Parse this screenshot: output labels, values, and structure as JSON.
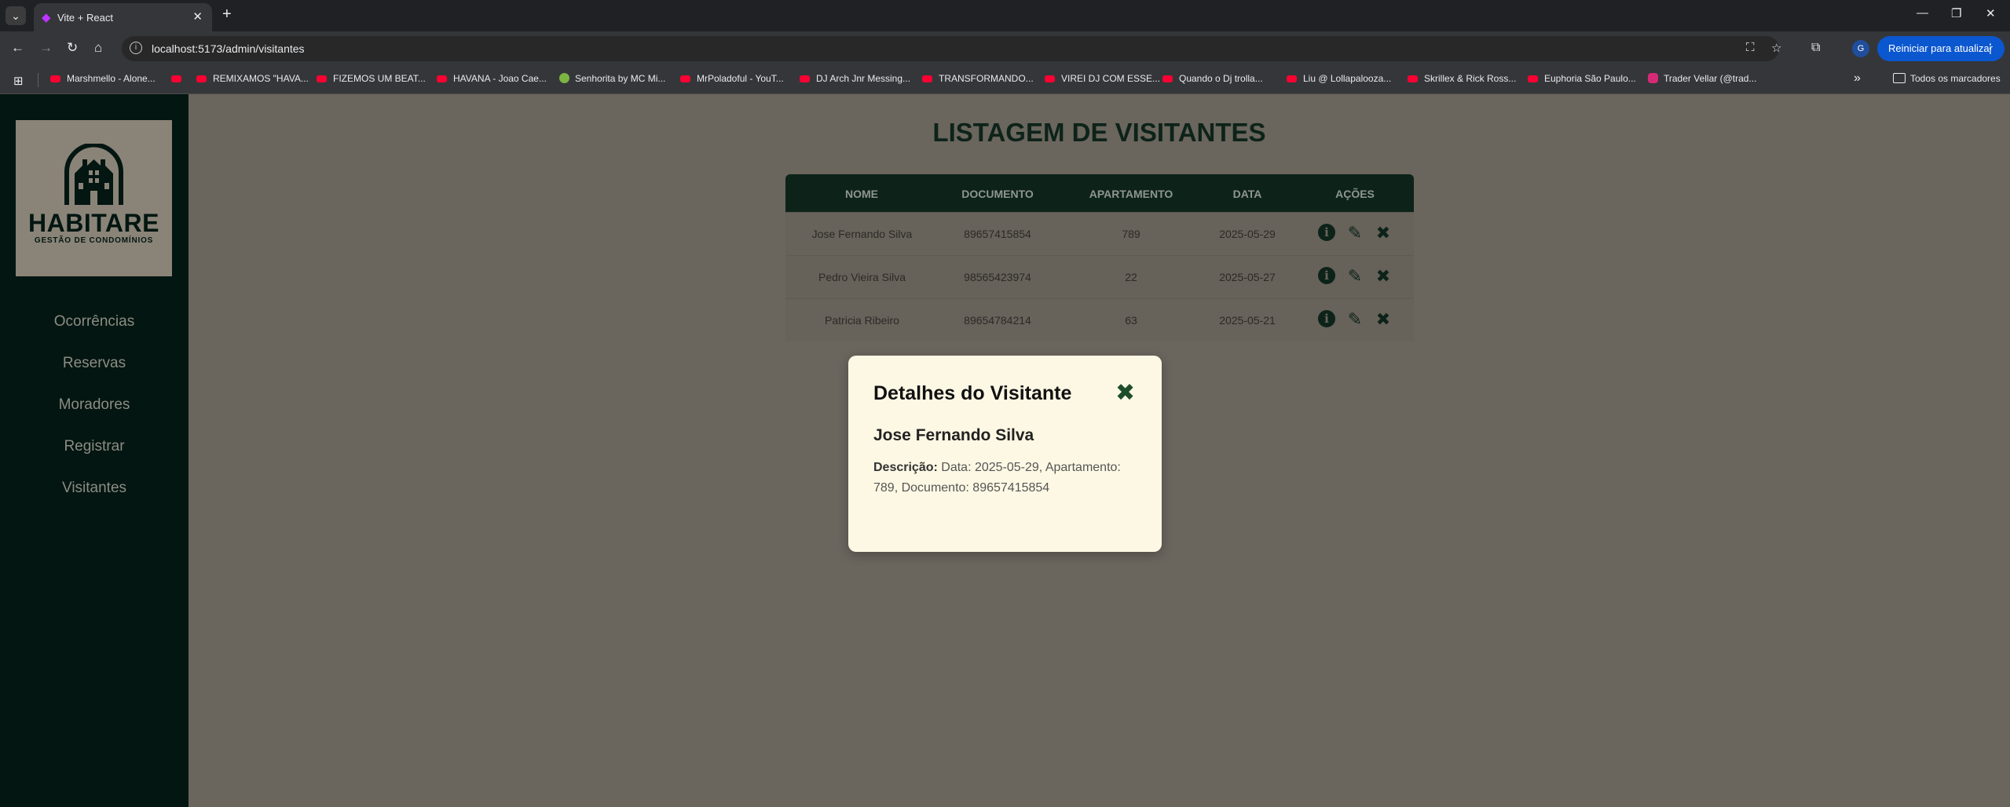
{
  "browser": {
    "tab_title": "Vite + React",
    "url": "localhost:5173/admin/visitantes",
    "update_button": "Reiniciar para atualizar",
    "profile_initial": "G",
    "bookmarks": [
      {
        "label": "Marshmello - Alone...",
        "icon": "youtube"
      },
      {
        "label": "",
        "icon": "youtube"
      },
      {
        "label": "REMIXAMOS \"HAVA...",
        "icon": "youtube"
      },
      {
        "label": "FIZEMOS UM BEAT...",
        "icon": "youtube"
      },
      {
        "label": "HAVANA - Joao Cae...",
        "icon": "youtube"
      },
      {
        "label": "Senhorita by MC Mi...",
        "icon": "globe"
      },
      {
        "label": "MrPoladoful - YouT...",
        "icon": "youtube"
      },
      {
        "label": "DJ Arch Jnr Messing...",
        "icon": "youtube"
      },
      {
        "label": "TRANSFORMANDO...",
        "icon": "youtube"
      },
      {
        "label": "VIREI DJ COM ESSE...",
        "icon": "youtube"
      },
      {
        "label": "Quando o Dj trolla...",
        "icon": "youtube"
      },
      {
        "label": "Liu @ Lollapalooza...",
        "icon": "youtube"
      },
      {
        "label": "Skrillex & Rick Ross...",
        "icon": "youtube"
      },
      {
        "label": "Euphoria São Paulo...",
        "icon": "youtube"
      },
      {
        "label": "Trader Vellar (@trad...",
        "icon": "instagram"
      }
    ],
    "all_bookmarks": "Todos os marcadores"
  },
  "sidebar": {
    "logo_name": "HABITARE",
    "logo_sub": "GESTÃO DE CONDOMÍNIOS",
    "menu": [
      "Ocorrências",
      "Reservas",
      "Moradores",
      "Registrar",
      "Visitantes"
    ]
  },
  "page": {
    "title": "LISTAGEM DE VISITANTES",
    "columns": [
      "NOME",
      "DOCUMENTO",
      "APARTAMENTO",
      "DATA",
      "AÇÕES"
    ],
    "rows": [
      {
        "nome": "Jose Fernando Silva",
        "documento": "89657415854",
        "apartamento": "789",
        "data": "2025-05-29"
      },
      {
        "nome": "Pedro Vieira Silva",
        "documento": "98565423974",
        "apartamento": "22",
        "data": "2025-05-27"
      },
      {
        "nome": "Patricia Ribeiro",
        "documento": "89654784214",
        "apartamento": "63",
        "data": "2025-05-21"
      }
    ]
  },
  "modal": {
    "title": "Detalhes do Visitante",
    "name": "Jose Fernando Silva",
    "desc_label": "Descrição:",
    "desc_text": " Data: 2025-05-29, Apartamento: 789, Documento: 89657415854"
  },
  "icons": {
    "info": "i",
    "edit": "✎",
    "delete": "✖",
    "close": "✖"
  },
  "colors": {
    "sidebar_bg": "#031611",
    "header_bg": "#0d2319",
    "main_bg": "#6a655d",
    "modal_bg": "#fdf8e4",
    "accent": "#1e4d2b"
  }
}
